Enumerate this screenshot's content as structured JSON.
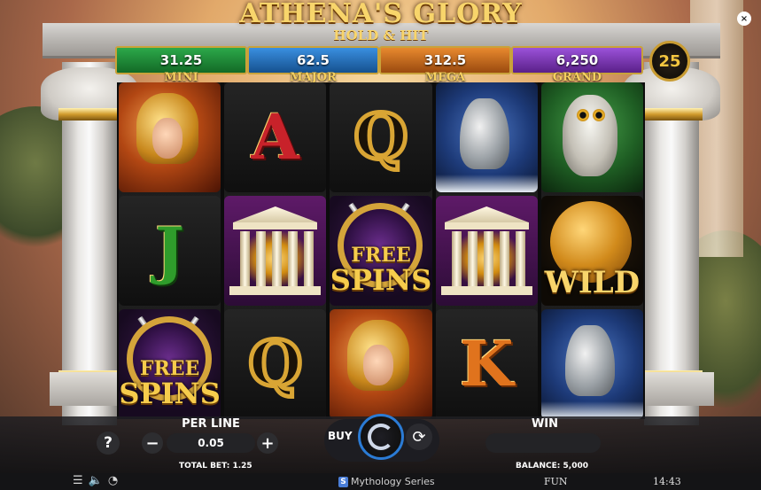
{
  "title": {
    "main": "ATHENA'S GLORY",
    "sub": "HOLD & HIT"
  },
  "jackpots": [
    {
      "label": "MINI",
      "value": "31.25",
      "color": "#1f8a38"
    },
    {
      "label": "MAJOR",
      "value": "62.5",
      "color": "#2a72bd"
    },
    {
      "label": "MEGA",
      "value": "312.5",
      "color": "#c86a20"
    },
    {
      "label": "GRAND",
      "value": "6,250",
      "color": "#7a3bb5"
    }
  ],
  "paylines": "25",
  "reels": [
    [
      {
        "symbol": "warrior-icon"
      },
      {
        "symbol": "J",
        "text": "J"
      },
      {
        "symbol": "free-spins-icon",
        "text_a": "FREE",
        "text_b": "SPINS"
      }
    ],
    [
      {
        "symbol": "A",
        "text": "A"
      },
      {
        "symbol": "temple-icon"
      },
      {
        "symbol": "Q",
        "text": "Q"
      }
    ],
    [
      {
        "symbol": "Q",
        "text": "Q"
      },
      {
        "symbol": "free-spins-icon",
        "text_a": "FREE",
        "text_b": "SPINS"
      },
      {
        "symbol": "warrior-icon"
      }
    ],
    [
      {
        "symbol": "vase-icon"
      },
      {
        "symbol": "temple-icon"
      },
      {
        "symbol": "K",
        "text": "K"
      }
    ],
    [
      {
        "symbol": "owl-icon"
      },
      {
        "symbol": "wild-icon",
        "text": "WILD"
      },
      {
        "symbol": "vase-icon"
      }
    ]
  ],
  "controls": {
    "help": "?",
    "per_line_label": "PER LINE",
    "per_line_value": "0.05",
    "minus": "−",
    "plus": "+",
    "total_bet": "TOTAL BET: 1.25",
    "buy": "BUY",
    "win_label": "WIN",
    "balance": "BALANCE: 5,000"
  },
  "footer": {
    "brand": "Mythology Series",
    "brand_logo": "S",
    "mode": "FUN",
    "time": "14:43"
  },
  "close": "×",
  "colors": {
    "accent_gold": "#d4a43a",
    "spin_ring": "#2b7bd4"
  }
}
